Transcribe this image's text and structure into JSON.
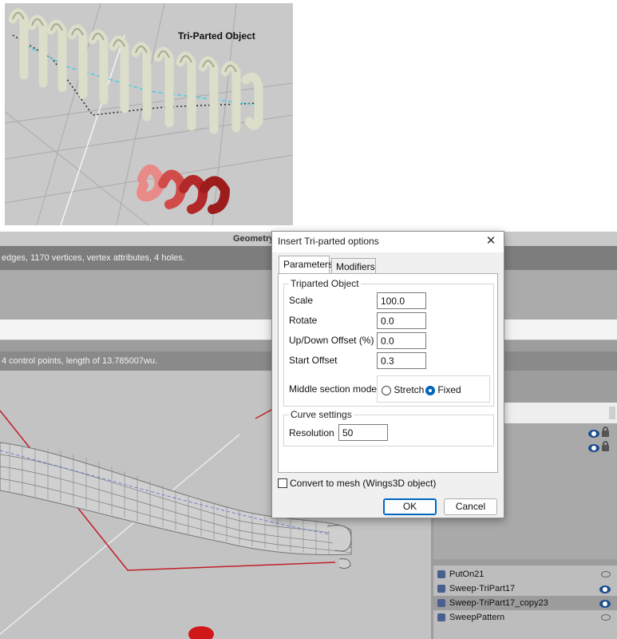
{
  "preview": {
    "label": "Tri-Parted Object"
  },
  "app": {
    "geometry_title": "Geometry",
    "geometry_info": "edges, 1170 vertices, vertex attributes, 4 holes.",
    "curve_info": "4 control points, length of 13.785007wu."
  },
  "dialog": {
    "title": "Insert Tri-parted options",
    "close_label": "✕",
    "tabs": [
      {
        "label": "Parameters",
        "active": true
      },
      {
        "label": "Modifiers",
        "active": false
      }
    ],
    "triparted_group": {
      "title": "Triparted Object",
      "fields": [
        {
          "label": "Scale",
          "value": "100.0"
        },
        {
          "label": "Rotate",
          "value": "0.0"
        },
        {
          "label": "Up/Down Offset (%)",
          "value": "0.0"
        },
        {
          "label": "Start Offset",
          "value": "0.3"
        }
      ],
      "middle_mode": {
        "label": "Middle section mode",
        "options": [
          {
            "label": "Stretch",
            "selected": false
          },
          {
            "label": "Fixed",
            "selected": true
          }
        ]
      }
    },
    "curve_group": {
      "title": "Curve settings",
      "resolution_label": "Resolution",
      "resolution_value": "50"
    },
    "convert_label": "Convert to mesh (Wings3D object)",
    "convert_checked": false,
    "ok_label": "OK",
    "cancel_label": "Cancel"
  },
  "outliner": {
    "items": [
      {
        "name": "PutOn21",
        "visible": false,
        "selected": false
      },
      {
        "name": "Sweep-TriPart17",
        "visible": true,
        "selected": false
      },
      {
        "name": "Sweep-TriPart17_copy23",
        "visible": true,
        "selected": true
      },
      {
        "name": "SweepPattern",
        "visible": false,
        "selected": false
      }
    ]
  },
  "colors": {
    "accent": "#0067c0",
    "curve_red": "#c0202a",
    "coil_light": "#d9dcc6",
    "coil_pink": "#e77a7a",
    "coil_red": "#9d1c1c"
  }
}
